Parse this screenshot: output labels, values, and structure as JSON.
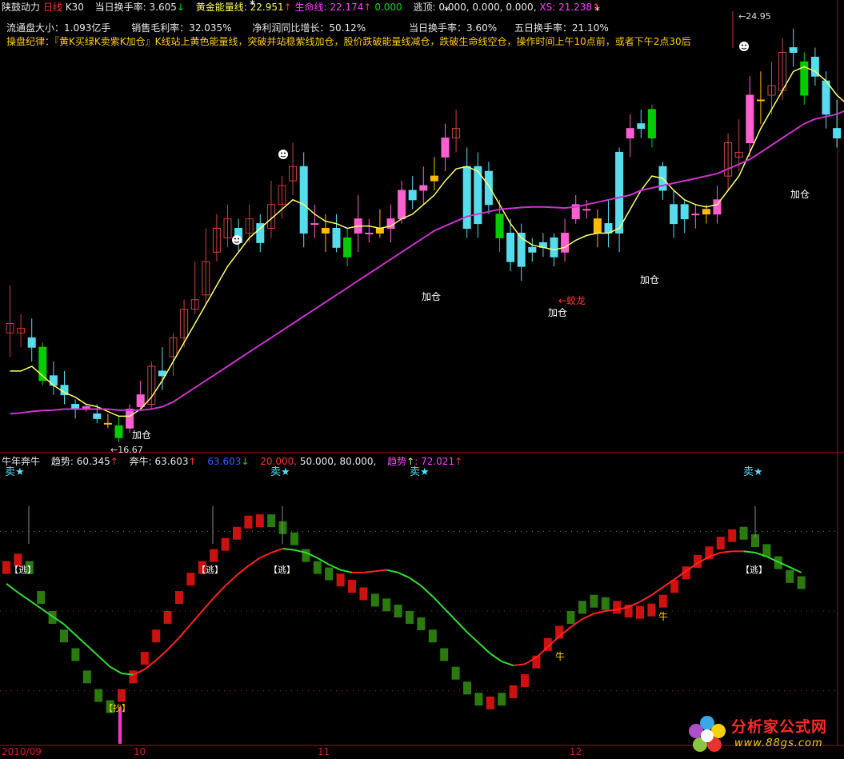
{
  "header": {
    "stock_name": "陕鼓动力",
    "period": "日线",
    "k_label": "K30",
    "today_turnover_label": "当日换手率:",
    "today_turnover_value": "3.605",
    "today_turnover_arrow": "↓",
    "golden_energy_label": "黄金能量线:",
    "golden_energy_value": "22.951",
    "golden_energy_arrow": "↑",
    "lifeline_label": "生命线:",
    "lifeline_value": "22.174",
    "lifeline_arrow": "↑",
    "green_value": "0.000",
    "escape_label": "逃顶:",
    "escape_values": "0.000, 0.000, 0.000,",
    "xs_label": "XS:",
    "xs_value": "21.238",
    "xs_arrow": "↑"
  },
  "stats": {
    "float_cap": "流通盘大小：1.093亿手",
    "gross_margin": "销售毛利率：32.035%",
    "profit_growth": "净利润同比增长：50.12%",
    "day_turnover": "当日换手率：3.60%",
    "five_day_turnover": "五日换手率：21.10%"
  },
  "strategy_text": "操盘纪律：『黄K买绿K卖紫K加仓』K线站上黄色能量线，突破并站稳紫线加仓，股价跌破能量线减仓，跌破生命线空仓，操作时间上午10点前，或者下午2点30后",
  "indicator_header": {
    "name": "牛年奔牛",
    "trend_label": "趋势:",
    "trend_value": "60.345",
    "trend_arrow": "↑",
    "bull_label": "奔牛:",
    "bull_value": "63.603",
    "bull_arrow": "↑",
    "blue_value": "63.603",
    "blue_arrow": "↓",
    "red_value": "20.000,",
    "levels": "50.000, 80.000,",
    "trend2_label": "趋势",
    "trend2_value": ": 72.021",
    "trend2_arrow": "↑"
  },
  "annotations": {
    "add_position": "加仓",
    "dragon": "←蛟龙",
    "high_price": "24.95",
    "low_price": "16.67",
    "sell": "卖★",
    "escape": "【逃】",
    "buy": "【抄】",
    "bull": "牛"
  },
  "x_axis": {
    "labels": [
      "2010/09",
      "10",
      "11",
      "12"
    ]
  },
  "watermark": {
    "text": "分析家公式网",
    "url": "www.88gs.com"
  },
  "colors": {
    "bull_up": "#ff5fd0",
    "bear": "#55ddee",
    "buy_k": "#ffbb00",
    "sell_k": "#00cc00",
    "energy_line": "#ffff66",
    "life_line": "#cc33cc",
    "ind_red": "#cc1111",
    "ind_green": "#2a7a10"
  },
  "chart_data": [
    {
      "type": "candlestick",
      "title": "陕鼓动力 日线",
      "ylim": [
        16.0,
        25.3
      ],
      "candles": [
        [
          18.5,
          18.7,
          19.5,
          18.0
        ],
        [
          18.6,
          18.5,
          18.9,
          18.2
        ],
        [
          18.4,
          18.2,
          18.8,
          17.9
        ],
        [
          18.2,
          17.5,
          18.3,
          17.4
        ],
        [
          17.6,
          17.4,
          17.9,
          17.2
        ],
        [
          17.4,
          17.2,
          17.7,
          17.0
        ],
        [
          17.0,
          16.9,
          17.1,
          16.7
        ],
        [
          16.9,
          16.95,
          17.0,
          16.85
        ],
        [
          16.8,
          16.7,
          17.0,
          16.6
        ],
        [
          16.6,
          16.6,
          16.8,
          16.5
        ],
        [
          16.55,
          16.3,
          16.75,
          16.2
        ],
        [
          16.5,
          16.9,
          17.0,
          16.4
        ],
        [
          16.95,
          17.2,
          17.5,
          16.9
        ],
        [
          17.0,
          17.8,
          17.9,
          16.9
        ],
        [
          17.7,
          17.6,
          18.2,
          17.3
        ],
        [
          18.0,
          18.4,
          18.5,
          17.6
        ],
        [
          18.4,
          19.0,
          19.2,
          18.2
        ],
        [
          19.0,
          19.2,
          20.0,
          18.9
        ],
        [
          19.3,
          20.0,
          20.7,
          19.1
        ],
        [
          20.2,
          20.7,
          21.0,
          20.0
        ],
        [
          20.9,
          20.5,
          21.2,
          20.3
        ],
        [
          20.7,
          20.4,
          20.9,
          20.2
        ],
        [
          20.6,
          20.9,
          21.2,
          20.4
        ],
        [
          20.8,
          20.4,
          21.0,
          20.2
        ],
        [
          20.7,
          21.2,
          21.7,
          20.5
        ],
        [
          21.2,
          21.6,
          21.8,
          20.9
        ],
        [
          21.7,
          22.0,
          22.5,
          21.4
        ],
        [
          22.0,
          20.6,
          22.3,
          20.3
        ],
        [
          20.8,
          20.8,
          21.2,
          20.5
        ],
        [
          20.6,
          20.7,
          21.0,
          20.2
        ],
        [
          20.7,
          20.3,
          21.0,
          20.2
        ],
        [
          20.5,
          20.1,
          20.7,
          19.9
        ],
        [
          20.6,
          20.9,
          21.4,
          20.2
        ],
        [
          20.6,
          20.6,
          20.9,
          20.4
        ],
        [
          20.6,
          20.7,
          21.1,
          20.5
        ],
        [
          20.7,
          20.9,
          21.2,
          20.4
        ],
        [
          20.9,
          21.5,
          21.7,
          20.8
        ],
        [
          21.5,
          21.3,
          21.8,
          21.1
        ],
        [
          21.5,
          21.6,
          22.0,
          21.2
        ],
        [
          21.7,
          21.8,
          22.2,
          21.5
        ],
        [
          22.2,
          22.6,
          22.9,
          21.9
        ],
        [
          22.6,
          22.8,
          23.2,
          22.3
        ],
        [
          22.0,
          20.7,
          22.4,
          20.5
        ],
        [
          22.0,
          20.8,
          22.3,
          20.5
        ],
        [
          21.9,
          21.2,
          22.1,
          21.0
        ],
        [
          21.0,
          20.5,
          21.3,
          20.2
        ],
        [
          20.6,
          20.0,
          20.9,
          19.8
        ],
        [
          20.6,
          19.9,
          20.8,
          19.6
        ],
        [
          20.3,
          20.2,
          20.5,
          20.0
        ],
        [
          20.4,
          20.3,
          20.6,
          20.1
        ],
        [
          20.5,
          20.1,
          20.6,
          19.9
        ],
        [
          20.2,
          20.6,
          20.9,
          20.0
        ],
        [
          20.9,
          21.2,
          21.4,
          20.8
        ],
        [
          21.1,
          21.1,
          21.3,
          20.9
        ],
        [
          20.6,
          20.9,
          21.1,
          20.3
        ],
        [
          20.8,
          20.6,
          21.3,
          20.3
        ],
        [
          22.3,
          20.6,
          22.4,
          20.2
        ],
        [
          22.6,
          22.8,
          23.1,
          22.2
        ],
        [
          22.9,
          22.8,
          23.2,
          22.6
        ],
        [
          23.2,
          22.6,
          23.3,
          22.4
        ],
        [
          22.0,
          21.5,
          22.1,
          21.3
        ],
        [
          21.2,
          20.8,
          21.5,
          20.5
        ],
        [
          21.2,
          20.9,
          21.3,
          20.6
        ],
        [
          21.0,
          21.0,
          21.2,
          20.7
        ],
        [
          21.0,
          21.1,
          21.2,
          20.8
        ],
        [
          21.0,
          21.3,
          21.6,
          20.8
        ],
        [
          21.8,
          22.5,
          22.7,
          21.5
        ],
        [
          22.2,
          22.3,
          23.0,
          21.9
        ],
        [
          22.5,
          23.5,
          23.9,
          22.2
        ],
        [
          23.4,
          23.4,
          24.0,
          22.9
        ],
        [
          23.5,
          23.7,
          24.2,
          23.1
        ],
        [
          23.6,
          24.4,
          24.7,
          23.4
        ],
        [
          24.5,
          24.4,
          24.9,
          24.1
        ],
        [
          24.2,
          23.5,
          24.4,
          23.3
        ],
        [
          24.3,
          23.9,
          24.5,
          23.7
        ],
        [
          23.8,
          23.1,
          24.0,
          22.8
        ],
        [
          22.8,
          22.6,
          23.4,
          22.4
        ],
        [
          22.6,
          22.6,
          23.2,
          22.5
        ],
        [
          23.8,
          22.9,
          24.0,
          22.8
        ],
        [
          23.5,
          23.3,
          23.7,
          23.2
        ]
      ],
      "energy_line": [
        17.7,
        17.7,
        17.8,
        17.6,
        17.4,
        17.25,
        17.15,
        17.0,
        16.95,
        16.85,
        16.75,
        16.75,
        16.9,
        17.15,
        17.5,
        17.9,
        18.3,
        18.7,
        19.1,
        19.5,
        19.9,
        20.2,
        20.5,
        20.7,
        20.9,
        21.1,
        21.3,
        21.2,
        21.0,
        20.85,
        20.8,
        20.7,
        20.75,
        20.75,
        20.7,
        20.75,
        20.9,
        21.0,
        21.2,
        21.4,
        21.7,
        21.95,
        22.0,
        21.9,
        21.6,
        21.2,
        20.8,
        20.5,
        20.35,
        20.3,
        20.25,
        20.3,
        20.45,
        20.55,
        20.6,
        20.6,
        20.7,
        21.1,
        21.5,
        21.8,
        21.75,
        21.5,
        21.3,
        21.2,
        21.15,
        21.2,
        21.5,
        21.8,
        22.3,
        22.8,
        23.2,
        23.6,
        24.0,
        24.1,
        24.0,
        23.8,
        23.5,
        23.3,
        23.4,
        23.4
      ],
      "life_line": [
        16.8,
        16.82,
        16.85,
        16.87,
        16.88,
        16.9,
        16.9,
        16.9,
        16.9,
        16.9,
        16.88,
        16.88,
        16.88,
        16.9,
        16.95,
        17.05,
        17.2,
        17.35,
        17.5,
        17.65,
        17.8,
        17.95,
        18.1,
        18.25,
        18.4,
        18.55,
        18.7,
        18.85,
        19.0,
        19.15,
        19.3,
        19.45,
        19.6,
        19.75,
        19.9,
        20.05,
        20.2,
        20.35,
        20.5,
        20.65,
        20.75,
        20.85,
        20.95,
        21.0,
        21.05,
        21.1,
        21.12,
        21.14,
        21.15,
        21.15,
        21.14,
        21.13,
        21.15,
        21.2,
        21.25,
        21.3,
        21.35,
        21.4,
        21.5,
        21.55,
        21.6,
        21.65,
        21.7,
        21.75,
        21.8,
        21.85,
        21.95,
        22.05,
        22.15,
        22.3,
        22.45,
        22.6,
        22.75,
        22.9,
        23.0,
        23.05,
        23.1,
        23.2,
        23.3,
        23.4
      ]
    },
    {
      "type": "bar",
      "title": "牛年奔牛",
      "ylim": [
        0,
        100
      ],
      "levels": [
        20,
        50,
        80
      ],
      "bull": [
        66.4,
        69.2,
        66.4,
        55.1,
        47.6,
        40.6,
        33.6,
        25.2,
        18.2,
        14.0,
        18.2,
        25.2,
        32.2,
        40.6,
        47.6,
        55.1,
        62.0,
        66.4,
        70.9,
        75.1,
        79.3,
        83.5,
        84.0,
        84.0,
        81.4,
        77.2,
        70.9,
        66.4,
        64.0,
        61.7,
        59.3,
        56.5,
        54.1,
        52.3,
        50.0,
        47.6,
        45.2,
        40.6,
        33.6,
        26.6,
        21.0,
        16.8,
        15.4,
        16.8,
        19.6,
        23.8,
        30.8,
        37.4,
        42.0,
        47.6,
        51.4,
        53.7,
        52.8,
        51.4,
        50.0,
        49.5,
        50.4,
        53.7,
        59.3,
        64.4,
        68.7,
        71.9,
        75.6,
        78.4,
        79.3,
        76.5,
        72.8,
        68.2,
        63.0,
        60.7
      ],
      "bull_up": [
        true,
        true,
        false,
        false,
        false,
        false,
        false,
        false,
        false,
        false,
        true,
        true,
        true,
        true,
        true,
        true,
        true,
        true,
        true,
        true,
        true,
        true,
        true,
        false,
        false,
        false,
        false,
        false,
        false,
        true,
        true,
        true,
        false,
        false,
        false,
        false,
        false,
        false,
        false,
        false,
        false,
        false,
        true,
        false,
        true,
        true,
        true,
        true,
        true,
        false,
        false,
        false,
        false,
        true,
        true,
        true,
        true,
        true,
        true,
        true,
        true,
        true,
        true,
        true,
        false,
        false,
        false,
        false,
        false,
        false
      ],
      "trend": [
        60.3,
        57.0,
        54.0,
        51.0,
        48.0,
        45.0,
        41.0,
        37.0,
        33.0,
        29.0,
        26.5,
        26.0,
        28.0,
        31.5,
        35.5,
        40.0,
        45.0,
        50.0,
        55.0,
        59.5,
        63.5,
        67.0,
        70.0,
        72.0,
        73.5,
        73.0,
        72.0,
        70.0,
        67.5,
        65.5,
        64.5,
        64.5,
        65.0,
        65.5,
        64.5,
        62.5,
        59.5,
        55.5,
        51.0,
        46.5,
        42.0,
        38.0,
        34.0,
        31.0,
        29.5,
        30.0,
        32.5,
        36.5,
        40.5,
        44.0,
        47.0,
        49.0,
        50.0,
        50.5,
        51.5,
        53.5,
        56.0,
        59.0,
        62.0,
        65.0,
        68.0,
        70.5,
        72.0,
        72.5,
        72.5,
        72.0,
        70.5,
        68.5,
        66.5,
        64.5
      ]
    }
  ]
}
